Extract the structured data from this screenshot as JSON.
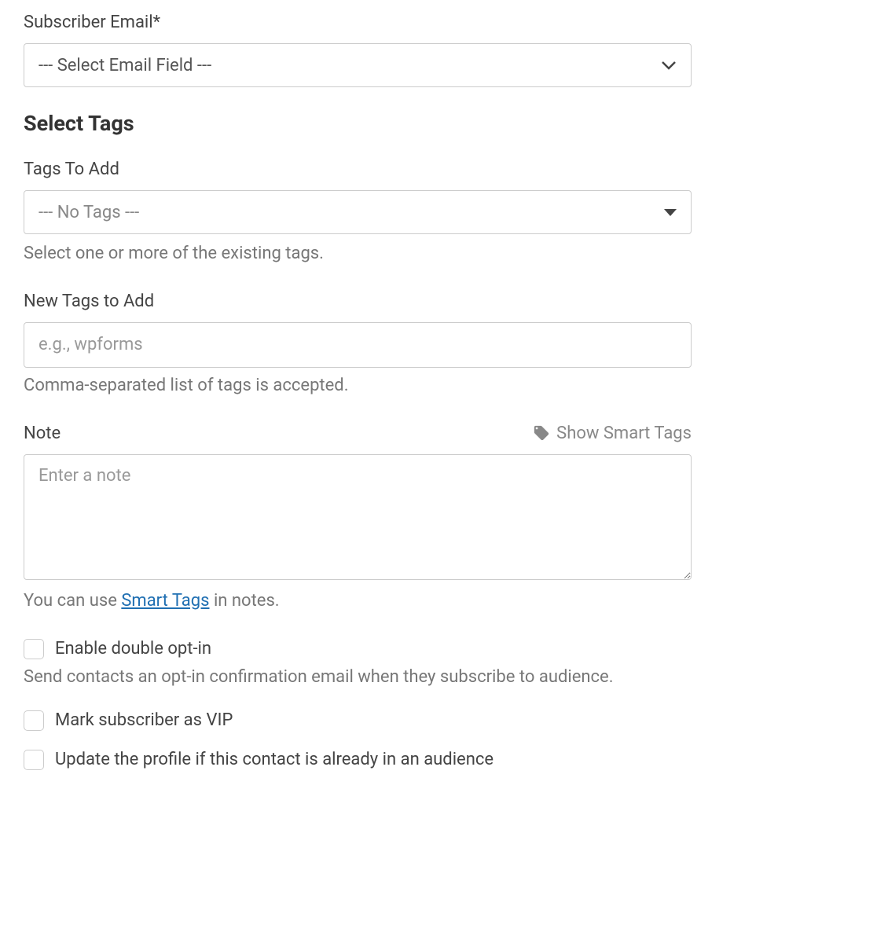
{
  "subscriberEmail": {
    "label": "Subscriber Email*",
    "selected": "--- Select Email Field ---"
  },
  "selectTags": {
    "heading": "Select Tags",
    "tagsToAdd": {
      "label": "Tags To Add",
      "selected": "--- No Tags ---",
      "help": "Select one or more of the existing tags."
    },
    "newTags": {
      "label": "New Tags to Add",
      "placeholder": "e.g., wpforms",
      "help": "Comma-separated list of tags is accepted."
    }
  },
  "note": {
    "label": "Note",
    "smartTagsToggle": "Show Smart Tags",
    "placeholder": "Enter a note",
    "helpPrefix": "You can use ",
    "helpLink": "Smart Tags",
    "helpSuffix": " in notes."
  },
  "options": {
    "doubleOptIn": {
      "label": "Enable double opt-in",
      "help": "Send contacts an opt-in confirmation email when they subscribe to audience."
    },
    "markVip": {
      "label": "Mark subscriber as VIP"
    },
    "updateProfile": {
      "label": "Update the profile if this contact is already in an audience"
    }
  }
}
